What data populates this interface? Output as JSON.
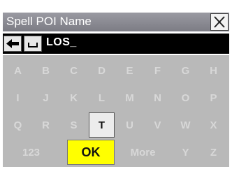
{
  "dialog": {
    "title": "Spell POI Name",
    "entry_text": "LOS_"
  },
  "icons": {
    "close": "close-x-icon",
    "backspace": "left-arrow-icon",
    "space": "space-bar-icon"
  },
  "keyboard": {
    "rows": [
      [
        "A",
        "B",
        "C",
        "D",
        "E",
        "F",
        "G",
        "H"
      ],
      [
        "I",
        "J",
        "K",
        "L",
        "M",
        "N",
        "O",
        "P"
      ],
      [
        "Q",
        "R",
        "S",
        "T",
        "U",
        "V",
        "W",
        "X"
      ]
    ],
    "bottom": {
      "numbers": "123",
      "ok": "OK",
      "more": "More",
      "y": "Y",
      "z": "Z"
    }
  },
  "colors": {
    "keyboard_bg": "#b9b9b9",
    "ok_bg": "#ffff00",
    "entry_bg": "#000000",
    "title_bg": "#8a8a92"
  }
}
